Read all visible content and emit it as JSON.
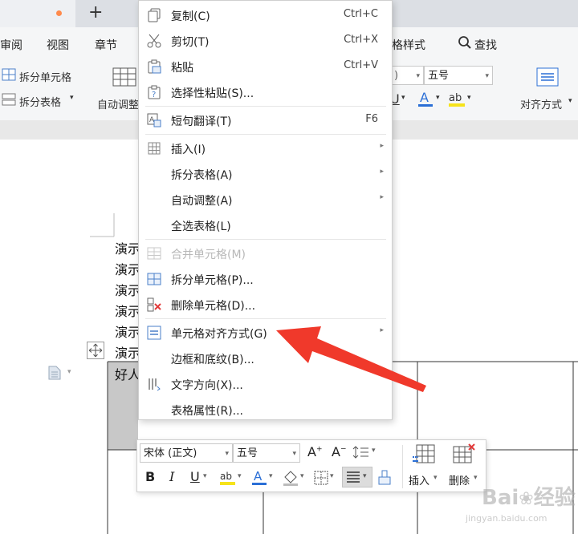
{
  "tabbar": {
    "new_tab": "+"
  },
  "menubar": {
    "items": [
      "审阅",
      "视图",
      "章节"
    ],
    "table_style": "格样式",
    "search": "查找"
  },
  "ribbon": {
    "split_cells": "拆分单元格",
    "split_table": "拆分表格",
    "auto_adjust": "自动调整",
    "font_size": "五号",
    "align": "对齐方式"
  },
  "document": {
    "lines": [
      "演示",
      "演示",
      "演示",
      "演示",
      "演示",
      "演示"
    ],
    "cell_text": "好人"
  },
  "context_menu": {
    "copy": {
      "label": "复制(C)",
      "shortcut": "Ctrl+C"
    },
    "cut": {
      "label": "剪切(T)",
      "shortcut": "Ctrl+X"
    },
    "paste": {
      "label": "粘贴",
      "shortcut": "Ctrl+V"
    },
    "paste_special": {
      "label": "选择性粘贴(S)..."
    },
    "translate": {
      "label": "短句翻译(T)",
      "shortcut": "F6"
    },
    "insert": {
      "label": "插入(I)"
    },
    "split_table": {
      "label": "拆分表格(A)"
    },
    "auto_adjust": {
      "label": "自动调整(A)"
    },
    "select_table": {
      "label": "全选表格(L)"
    },
    "merge_cells": {
      "label": "合并单元格(M)"
    },
    "split_cells": {
      "label": "拆分单元格(P)..."
    },
    "delete_cells": {
      "label": "删除单元格(D)..."
    },
    "cell_align": {
      "label": "单元格对齐方式(G)"
    },
    "borders": {
      "label": "边框和底纹(B)..."
    },
    "text_direction": {
      "label": "文字方向(X)..."
    },
    "table_props": {
      "label": "表格属性(R)..."
    }
  },
  "mini_toolbar": {
    "font_name": "宋体 (正文)",
    "font_size": "五号",
    "bold": "B",
    "italic": "I",
    "underline": "U",
    "insert": "插入",
    "delete": "删除"
  },
  "watermark": {
    "brand": "经验",
    "url": "jingyan.baidu.com"
  },
  "colors": {
    "arrow": "#f0392b",
    "accent": "#2b6fd6",
    "selected_cell": "#c8c8c8"
  }
}
